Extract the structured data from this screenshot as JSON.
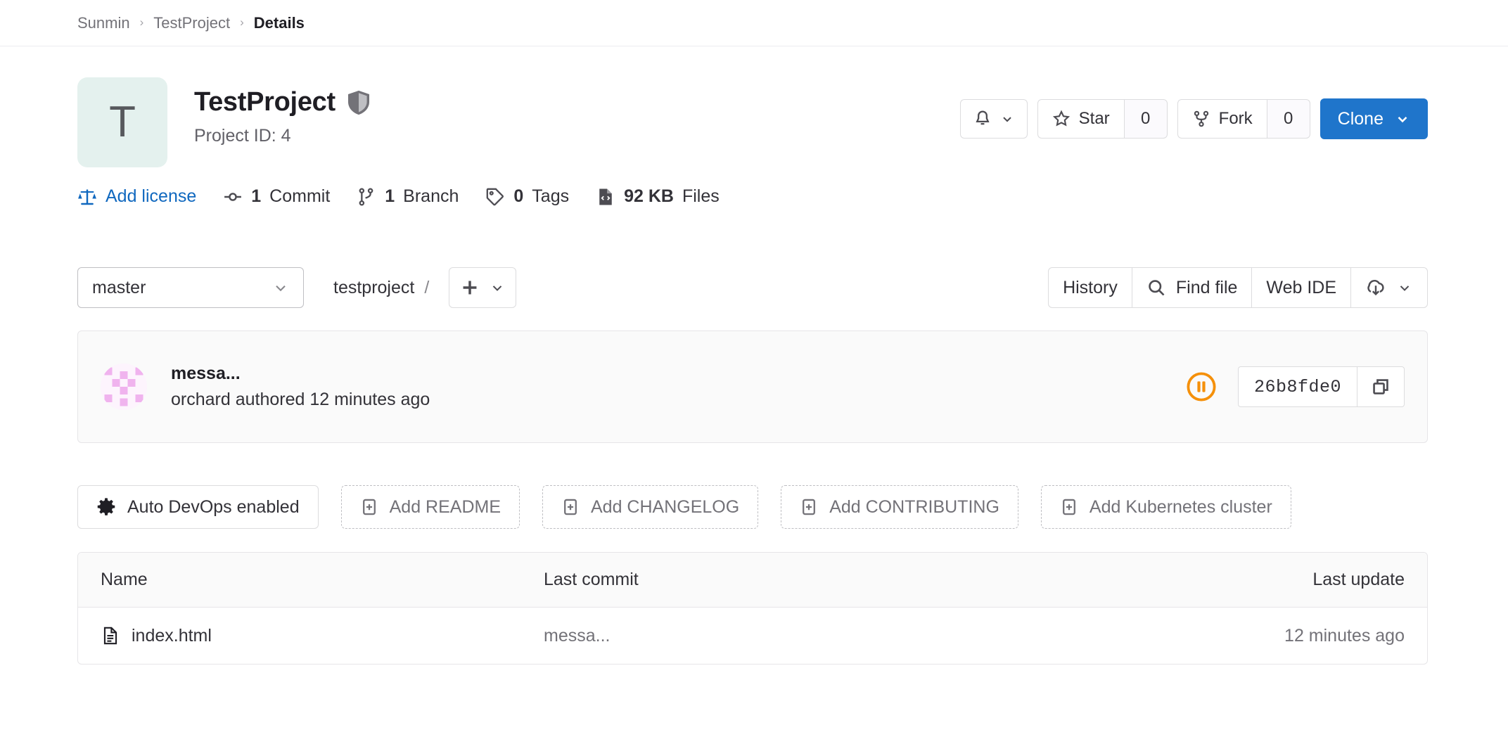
{
  "breadcrumb": {
    "items": [
      {
        "label": "Sunmin",
        "active": false
      },
      {
        "label": "TestProject",
        "active": false
      },
      {
        "label": "Details",
        "active": true
      }
    ],
    "separator": "›"
  },
  "project": {
    "avatar_letter": "T",
    "avatar_bg": "#e4f1ee",
    "title": "TestProject",
    "visibility_icon": "shield-icon",
    "project_id_label": "Project ID: 4"
  },
  "header_actions": {
    "notifications": {
      "icon": "bell-icon",
      "caret": "chevron-down-icon"
    },
    "star": {
      "icon": "star-icon",
      "label": "Star",
      "count": "0"
    },
    "fork": {
      "icon": "fork-icon",
      "label": "Fork",
      "count": "0"
    },
    "clone": {
      "label": "Clone",
      "caret": "chevron-down-icon",
      "color": "#1f75cb"
    }
  },
  "stats": [
    {
      "icon": "scale-icon",
      "label": "Add license",
      "value": "",
      "link": true
    },
    {
      "icon": "commit-icon",
      "value": "1",
      "label": "Commit",
      "link": false
    },
    {
      "icon": "branch-icon",
      "value": "1",
      "label": "Branch",
      "link": false
    },
    {
      "icon": "tag-icon",
      "value": "0",
      "label": "Tags",
      "link": false
    },
    {
      "icon": "file-code-icon",
      "value": "92 KB",
      "label": "Files",
      "link": false
    }
  ],
  "toolbar": {
    "branch": "master",
    "path_segment": "testproject",
    "path_slash": "/",
    "plus_label": "+",
    "history_label": "History",
    "find_file_label": "Find file",
    "web_ide_label": "Web IDE",
    "download_icon": "download-cloud-icon"
  },
  "commit": {
    "avatar": "identicon-avatar",
    "title": "messa...",
    "subtitle": "orchard authored 12 minutes ago",
    "pipeline_status": "pipeline-paused-icon",
    "pipeline_color": "#f5900a",
    "sha": "26b8fde0",
    "copy_icon": "copy-icon"
  },
  "quick_actions": [
    {
      "label": "Auto DevOps enabled",
      "icon": "gear-icon",
      "style": "solid"
    },
    {
      "label": "Add README",
      "icon": "plus-square-icon",
      "style": "dashed"
    },
    {
      "label": "Add CHANGELOG",
      "icon": "plus-square-icon",
      "style": "dashed"
    },
    {
      "label": "Add CONTRIBUTING",
      "icon": "plus-square-icon",
      "style": "dashed"
    },
    {
      "label": "Add Kubernetes cluster",
      "icon": "plus-square-icon",
      "style": "dashed"
    }
  ],
  "file_table": {
    "columns": {
      "name": "Name",
      "last_commit": "Last commit",
      "last_update": "Last update"
    },
    "rows": [
      {
        "icon": "file-doc-icon",
        "name": "index.html",
        "last_commit": "messa...",
        "last_update": "12 minutes ago"
      }
    ]
  }
}
